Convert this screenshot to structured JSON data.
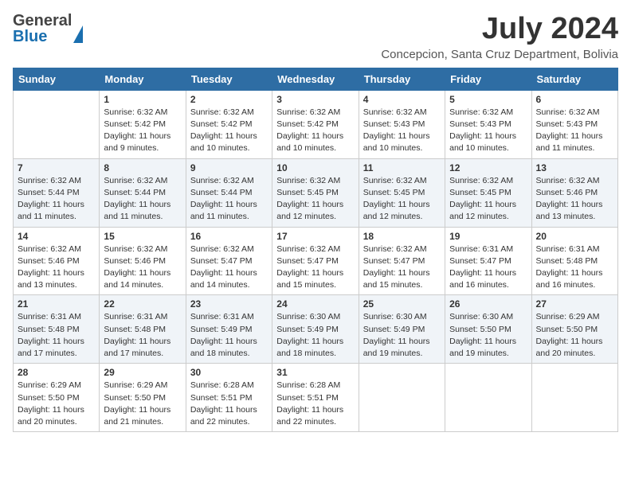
{
  "logo": {
    "general": "General",
    "blue": "Blue"
  },
  "title": {
    "month_year": "July 2024",
    "location": "Concepcion, Santa Cruz Department, Bolivia"
  },
  "days_of_week": [
    "Sunday",
    "Monday",
    "Tuesday",
    "Wednesday",
    "Thursday",
    "Friday",
    "Saturday"
  ],
  "weeks": [
    [
      {
        "day": "",
        "sunrise": "",
        "sunset": "",
        "daylight": ""
      },
      {
        "day": "1",
        "sunrise": "Sunrise: 6:32 AM",
        "sunset": "Sunset: 5:42 PM",
        "daylight": "Daylight: 11 hours and 9 minutes."
      },
      {
        "day": "2",
        "sunrise": "Sunrise: 6:32 AM",
        "sunset": "Sunset: 5:42 PM",
        "daylight": "Daylight: 11 hours and 10 minutes."
      },
      {
        "day": "3",
        "sunrise": "Sunrise: 6:32 AM",
        "sunset": "Sunset: 5:42 PM",
        "daylight": "Daylight: 11 hours and 10 minutes."
      },
      {
        "day": "4",
        "sunrise": "Sunrise: 6:32 AM",
        "sunset": "Sunset: 5:43 PM",
        "daylight": "Daylight: 11 hours and 10 minutes."
      },
      {
        "day": "5",
        "sunrise": "Sunrise: 6:32 AM",
        "sunset": "Sunset: 5:43 PM",
        "daylight": "Daylight: 11 hours and 10 minutes."
      },
      {
        "day": "6",
        "sunrise": "Sunrise: 6:32 AM",
        "sunset": "Sunset: 5:43 PM",
        "daylight": "Daylight: 11 hours and 11 minutes."
      }
    ],
    [
      {
        "day": "7",
        "sunrise": "Sunrise: 6:32 AM",
        "sunset": "Sunset: 5:44 PM",
        "daylight": "Daylight: 11 hours and 11 minutes."
      },
      {
        "day": "8",
        "sunrise": "Sunrise: 6:32 AM",
        "sunset": "Sunset: 5:44 PM",
        "daylight": "Daylight: 11 hours and 11 minutes."
      },
      {
        "day": "9",
        "sunrise": "Sunrise: 6:32 AM",
        "sunset": "Sunset: 5:44 PM",
        "daylight": "Daylight: 11 hours and 11 minutes."
      },
      {
        "day": "10",
        "sunrise": "Sunrise: 6:32 AM",
        "sunset": "Sunset: 5:45 PM",
        "daylight": "Daylight: 11 hours and 12 minutes."
      },
      {
        "day": "11",
        "sunrise": "Sunrise: 6:32 AM",
        "sunset": "Sunset: 5:45 PM",
        "daylight": "Daylight: 11 hours and 12 minutes."
      },
      {
        "day": "12",
        "sunrise": "Sunrise: 6:32 AM",
        "sunset": "Sunset: 5:45 PM",
        "daylight": "Daylight: 11 hours and 12 minutes."
      },
      {
        "day": "13",
        "sunrise": "Sunrise: 6:32 AM",
        "sunset": "Sunset: 5:46 PM",
        "daylight": "Daylight: 11 hours and 13 minutes."
      }
    ],
    [
      {
        "day": "14",
        "sunrise": "Sunrise: 6:32 AM",
        "sunset": "Sunset: 5:46 PM",
        "daylight": "Daylight: 11 hours and 13 minutes."
      },
      {
        "day": "15",
        "sunrise": "Sunrise: 6:32 AM",
        "sunset": "Sunset: 5:46 PM",
        "daylight": "Daylight: 11 hours and 14 minutes."
      },
      {
        "day": "16",
        "sunrise": "Sunrise: 6:32 AM",
        "sunset": "Sunset: 5:47 PM",
        "daylight": "Daylight: 11 hours and 14 minutes."
      },
      {
        "day": "17",
        "sunrise": "Sunrise: 6:32 AM",
        "sunset": "Sunset: 5:47 PM",
        "daylight": "Daylight: 11 hours and 15 minutes."
      },
      {
        "day": "18",
        "sunrise": "Sunrise: 6:32 AM",
        "sunset": "Sunset: 5:47 PM",
        "daylight": "Daylight: 11 hours and 15 minutes."
      },
      {
        "day": "19",
        "sunrise": "Sunrise: 6:31 AM",
        "sunset": "Sunset: 5:47 PM",
        "daylight": "Daylight: 11 hours and 16 minutes."
      },
      {
        "day": "20",
        "sunrise": "Sunrise: 6:31 AM",
        "sunset": "Sunset: 5:48 PM",
        "daylight": "Daylight: 11 hours and 16 minutes."
      }
    ],
    [
      {
        "day": "21",
        "sunrise": "Sunrise: 6:31 AM",
        "sunset": "Sunset: 5:48 PM",
        "daylight": "Daylight: 11 hours and 17 minutes."
      },
      {
        "day": "22",
        "sunrise": "Sunrise: 6:31 AM",
        "sunset": "Sunset: 5:48 PM",
        "daylight": "Daylight: 11 hours and 17 minutes."
      },
      {
        "day": "23",
        "sunrise": "Sunrise: 6:31 AM",
        "sunset": "Sunset: 5:49 PM",
        "daylight": "Daylight: 11 hours and 18 minutes."
      },
      {
        "day": "24",
        "sunrise": "Sunrise: 6:30 AM",
        "sunset": "Sunset: 5:49 PM",
        "daylight": "Daylight: 11 hours and 18 minutes."
      },
      {
        "day": "25",
        "sunrise": "Sunrise: 6:30 AM",
        "sunset": "Sunset: 5:49 PM",
        "daylight": "Daylight: 11 hours and 19 minutes."
      },
      {
        "day": "26",
        "sunrise": "Sunrise: 6:30 AM",
        "sunset": "Sunset: 5:50 PM",
        "daylight": "Daylight: 11 hours and 19 minutes."
      },
      {
        "day": "27",
        "sunrise": "Sunrise: 6:29 AM",
        "sunset": "Sunset: 5:50 PM",
        "daylight": "Daylight: 11 hours and 20 minutes."
      }
    ],
    [
      {
        "day": "28",
        "sunrise": "Sunrise: 6:29 AM",
        "sunset": "Sunset: 5:50 PM",
        "daylight": "Daylight: 11 hours and 20 minutes."
      },
      {
        "day": "29",
        "sunrise": "Sunrise: 6:29 AM",
        "sunset": "Sunset: 5:50 PM",
        "daylight": "Daylight: 11 hours and 21 minutes."
      },
      {
        "day": "30",
        "sunrise": "Sunrise: 6:28 AM",
        "sunset": "Sunset: 5:51 PM",
        "daylight": "Daylight: 11 hours and 22 minutes."
      },
      {
        "day": "31",
        "sunrise": "Sunrise: 6:28 AM",
        "sunset": "Sunset: 5:51 PM",
        "daylight": "Daylight: 11 hours and 22 minutes."
      },
      {
        "day": "",
        "sunrise": "",
        "sunset": "",
        "daylight": ""
      },
      {
        "day": "",
        "sunrise": "",
        "sunset": "",
        "daylight": ""
      },
      {
        "day": "",
        "sunrise": "",
        "sunset": "",
        "daylight": ""
      }
    ]
  ]
}
